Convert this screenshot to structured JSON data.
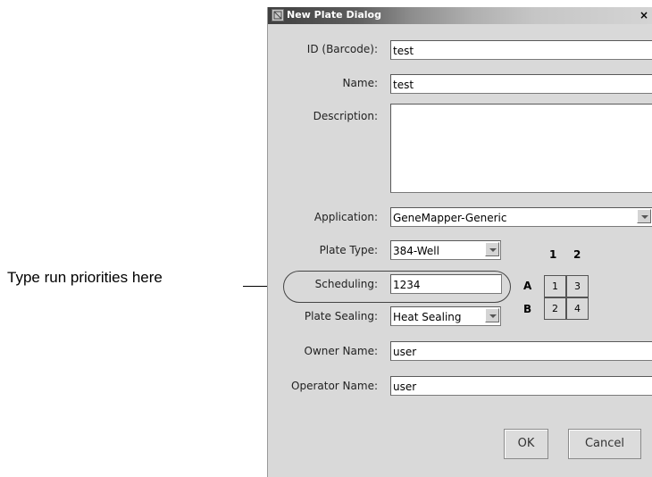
{
  "callout": {
    "text": "Type run priorities here"
  },
  "dialog": {
    "title": "New Plate Dialog",
    "close": "×",
    "fields": {
      "id": {
        "label": "ID (Barcode):",
        "value": "test"
      },
      "name": {
        "label": "Name:",
        "value": "test"
      },
      "description": {
        "label": "Description:",
        "value": ""
      },
      "application": {
        "label": "Application:",
        "value": "GeneMapper-Generic"
      },
      "plate_type": {
        "label": "Plate Type:",
        "value": "384-Well"
      },
      "scheduling": {
        "label": "Scheduling:",
        "value": "1234"
      },
      "plate_sealing": {
        "label": "Plate Sealing:",
        "value": "Heat Sealing"
      },
      "owner": {
        "label": "Owner Name:",
        "value": "user"
      },
      "operator": {
        "label": "Operator Name:",
        "value": "user"
      }
    },
    "grid": {
      "columns": [
        "1",
        "2"
      ],
      "rows": [
        "A",
        "B"
      ],
      "cells": [
        [
          "1",
          "3"
        ],
        [
          "2",
          "4"
        ]
      ]
    },
    "buttons": {
      "ok": "OK",
      "cancel": "Cancel"
    }
  },
  "icons": {
    "app": "app-icon",
    "dropdown": "chevron-down-icon"
  }
}
